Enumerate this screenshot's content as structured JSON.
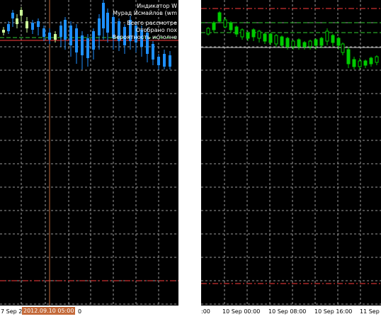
{
  "left_chart": {
    "overlay": {
      "line1": "Индикатор W",
      "line2": "Мурад Исмайлов (wm",
      "line3": "Всего рассмотре",
      "line4": "Отобрано пох",
      "line5": "Вероятность исполне"
    },
    "x_labels": [
      "7 Sep 2",
      "0"
    ],
    "crosshair_time": "2012.09.10 05:00",
    "candle_color": "#1e90ff",
    "bull_color": "#ccff99",
    "levels": {
      "red": "#ff3b3b",
      "green": "#33cc33"
    }
  },
  "right_chart": {
    "x_labels": [
      ":00",
      "10 Sep 00:00",
      "10 Sep 08:00",
      "10 Sep 16:00",
      "11 Sep"
    ],
    "candle_color": "#00cc00",
    "levels": {
      "red": "#ff3b3b",
      "green": "#33cc33"
    }
  },
  "colors": {
    "background": "#000000",
    "grid": "#9a9a9a"
  }
}
